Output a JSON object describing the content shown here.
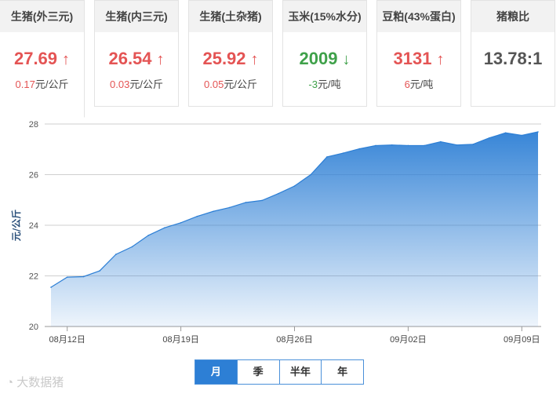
{
  "cards": [
    {
      "title": "生猪(外三元)",
      "price": "27.69",
      "dir": "up",
      "change": "0.17",
      "unit": "元/公斤"
    },
    {
      "title": "生猪(内三元)",
      "price": "26.54",
      "dir": "up",
      "change": "0.03",
      "unit": "元/公斤"
    },
    {
      "title": "生猪(土杂猪)",
      "price": "25.92",
      "dir": "up",
      "change": "0.05",
      "unit": "元/公斤"
    },
    {
      "title": "玉米(15%水分)",
      "price": "2009",
      "dir": "down",
      "change": "-3",
      "unit": "元/吨"
    },
    {
      "title": "豆粕(43%蛋白)",
      "price": "3131",
      "dir": "up",
      "change": "6",
      "unit": "元/吨"
    },
    {
      "title": "猪粮比",
      "price": "13.78:1",
      "dir": "flat",
      "change": "",
      "unit": ""
    }
  ],
  "period_buttons": [
    "月",
    "季",
    "半年",
    "年"
  ],
  "selected_period": "月",
  "watermark": "大数据猪",
  "colors": {
    "up": "#e45454",
    "down": "#3fa14a",
    "area": "#2d7fd5",
    "button": "#2d7fd5"
  },
  "chart_data": {
    "type": "area",
    "ylabel": "元/公斤",
    "ylim": [
      20,
      28
    ],
    "yticks": [
      20,
      22,
      24,
      26,
      28
    ],
    "xlabels": [
      "08月12日",
      "08月19日",
      "08月26日",
      "09月02日",
      "09月09日"
    ],
    "xlabel_positions": [
      1.5,
      8.5,
      15.5,
      22.5,
      29.5
    ],
    "grid": true,
    "series": [
      {
        "values": [
          21.55,
          21.95,
          21.97,
          22.2,
          22.85,
          23.15,
          23.6,
          23.9,
          24.1,
          24.35,
          24.55,
          24.7,
          24.9,
          24.98,
          25.25,
          25.55,
          26.0,
          26.7,
          26.85,
          27.02,
          27.15,
          27.17,
          27.15,
          27.15,
          27.3,
          27.17,
          27.2,
          27.45,
          27.65,
          27.55,
          27.69
        ]
      }
    ]
  }
}
